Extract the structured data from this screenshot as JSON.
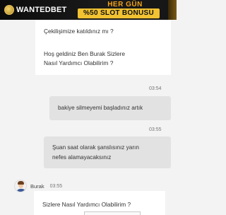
{
  "banner": {
    "brand": "WANTEDBET",
    "promo_line1": "HER GÜN",
    "promo_line2": "%50 SLOT BONUSU",
    "colors": {
      "background": "#111111",
      "accent": "#f2a21a",
      "promo_box": "#f1c232"
    }
  },
  "welcome_panel": {
    "line1": "Çekilişimize katıldınız mı ?",
    "line2": "Hoş geldiniz Ben Burak Sizlere",
    "line3": "Nasıl Yardımcı Olabilirim ?"
  },
  "messages": [
    {
      "time": "03:54",
      "text": "bakiye silmeyemi başladınız artık"
    },
    {
      "time": "03:55",
      "line1": "Şuan saat olarak şanslısınız yarın",
      "line2": "nefes alamayacaksınız"
    }
  ],
  "bot": {
    "name": "Burak",
    "time": "03:55",
    "message": "Sizlere Nasıl Yardımcı Olabilirim ?",
    "avatar_icon": "agent-avatar-icon"
  }
}
